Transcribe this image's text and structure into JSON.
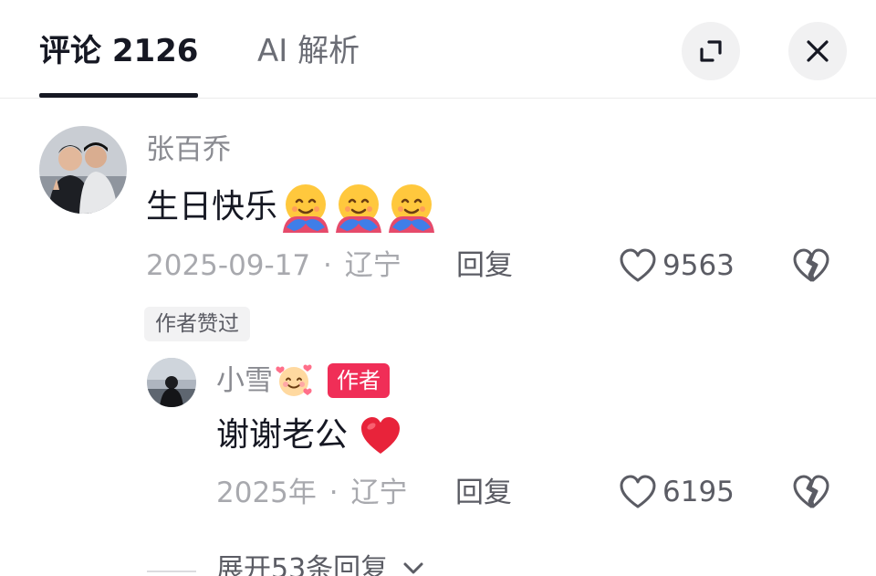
{
  "header": {
    "comments_tab_label": "评论 2126",
    "ai_tab_label": "AI 解析"
  },
  "comment": {
    "username": "张百乔",
    "text": "生日快乐",
    "emoji_count": 3,
    "date": "2025-09-17",
    "separator": "·",
    "location": "辽宁",
    "reply_label": "回复",
    "like_count": "9563",
    "author_liked_label": "作者赞过"
  },
  "reply": {
    "username": "小雪",
    "author_badge": "作者",
    "text": "谢谢老公",
    "date": "2025年",
    "separator": "·",
    "location": "辽宁",
    "reply_label": "回复",
    "like_count": "6195"
  },
  "expand_replies_label": "展开53条回复",
  "icons": {
    "expand": "expand-icon",
    "close": "close-icon",
    "like": "heart-outline-icon",
    "dislike": "broken-heart-icon",
    "chevron": "chevron-down-icon",
    "hug_emoji": "hugging-face-emoji",
    "heart_emoji": "red-heart-emoji",
    "smiling_hearts_emoji": "smiling-face-with-hearts-emoji"
  },
  "colors": {
    "author_badge": "#f02e57",
    "text_primary": "#161823",
    "text_secondary": "#8a8b91"
  }
}
